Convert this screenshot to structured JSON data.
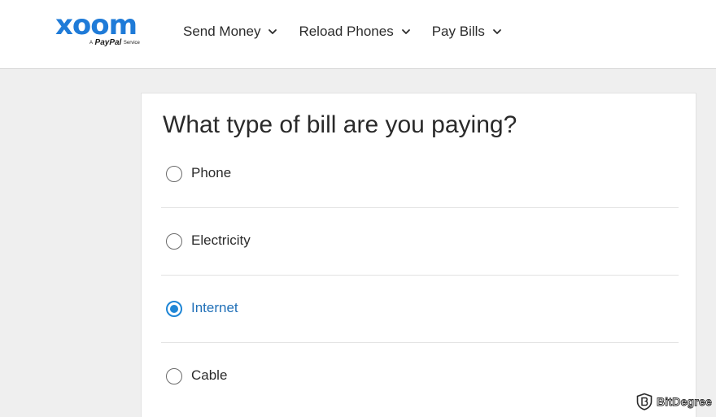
{
  "brand": {
    "name": "xoom",
    "tagline_prefix": "A",
    "tagline_brand": "PayPal",
    "tagline_suffix": "Service",
    "color": "#1f7bd8"
  },
  "nav": {
    "items": [
      {
        "label": "Send Money",
        "icon": "chevron-down-icon"
      },
      {
        "label": "Reload Phones",
        "icon": "chevron-down-icon"
      },
      {
        "label": "Pay Bills",
        "icon": "chevron-down-icon"
      }
    ]
  },
  "form": {
    "question": "What type of bill are you paying?",
    "selected_value": "Internet",
    "accent_color": "#1f86d6",
    "options": [
      {
        "label": "Phone",
        "checked": false
      },
      {
        "label": "Electricity",
        "checked": false
      },
      {
        "label": "Internet",
        "checked": true
      },
      {
        "label": "Cable",
        "checked": false
      }
    ]
  },
  "watermark": {
    "text": "BitDegree",
    "icon": "bitdegree-shield-icon"
  }
}
